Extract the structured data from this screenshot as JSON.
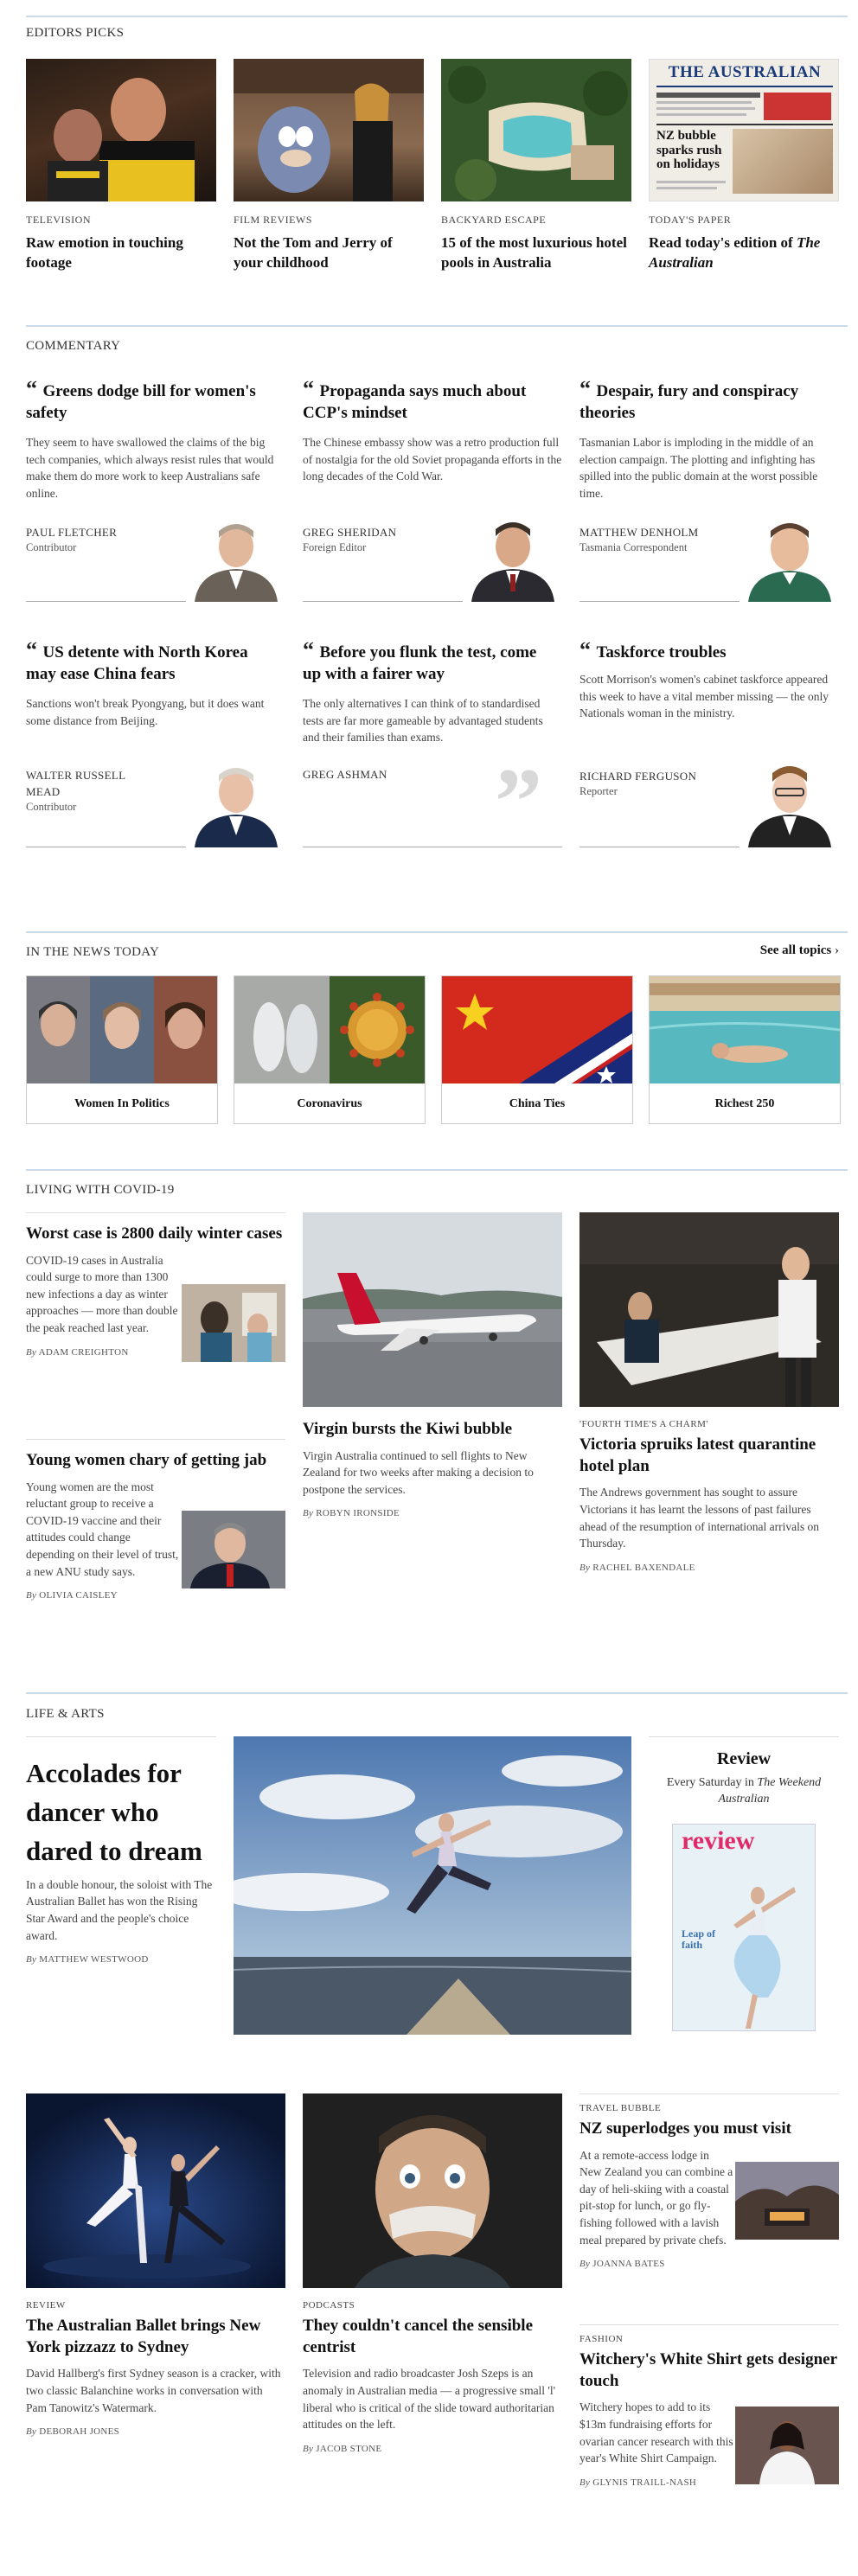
{
  "editors_picks": {
    "heading": "EDITORS PICKS",
    "items": [
      {
        "kicker": "TELEVISION",
        "title": "Raw emotion in touching footage"
      },
      {
        "kicker": "FILM REVIEWS",
        "title": "Not the Tom and Jerry of your childhood"
      },
      {
        "kicker": "BACKYARD ESCAPE",
        "title": "15 of the most luxurious hotel pools in Australia"
      },
      {
        "kicker": "TODAY'S PAPER",
        "title": "Read today's edition of",
        "title_em": "The Australian"
      }
    ],
    "paper": {
      "masthead": "THE AUSTRALIAN",
      "headline": "NZ bubble sparks rush on holidays"
    }
  },
  "commentary": {
    "heading": "COMMENTARY",
    "items": [
      {
        "title": "Greens dodge bill for women's safety",
        "body": "They seem to have swallowed the claims of the big tech companies, which always resist rules that would make them do more work to keep Australians safe online.",
        "name": "PAUL FLETCHER",
        "role": "Contributor"
      },
      {
        "title": "Propaganda says much about CCP's mindset",
        "body": "The Chinese embassy show was a retro production full of nostalgia for the old Soviet propaganda efforts in the long decades of the Cold War.",
        "name": "GREG SHERIDAN",
        "role": "Foreign Editor"
      },
      {
        "title": "Despair, fury and conspiracy theories",
        "body": "Tasmanian Labor is imploding in the middle of an election campaign. The plotting and infighting has spilled into the public domain at the worst possible time.",
        "name": "MATTHEW DENHOLM",
        "role": "Tasmania Correspondent"
      },
      {
        "title": "US detente with North Korea may ease China fears",
        "body": "Sanctions won't break Pyongyang, but it does want some distance from Beijing.",
        "name": "WALTER RUSSELL MEAD",
        "role": "Contributor"
      },
      {
        "title": "Before you flunk the test, come up with a fairer way",
        "body": "The only alternatives I can think of to standardised tests are far more gameable by advantaged students and their families than exams.",
        "name": "GREG ASHMAN",
        "role": ""
      },
      {
        "title": "Taskforce troubles",
        "body": "Scott Morrison's women's cabinet taskforce appeared this week to have a vital member missing — the only Nationals woman in the ministry.",
        "name": "RICHARD FERGUSON",
        "role": "Reporter"
      }
    ]
  },
  "in_the_news": {
    "heading": "IN THE NEWS TODAY",
    "see_all": "See all topics",
    "topics": [
      "Women In Politics",
      "Coronavirus",
      "China Ties",
      "Richest 250"
    ]
  },
  "covid": {
    "heading": "LIVING WITH COVID-19",
    "left": [
      {
        "title": "Worst case is 2800 daily winter cases",
        "body": "COVID-19 cases in Australia could surge to more than 1300 new infections a day as winter approaches — more than double the peak reached last year.",
        "by": "By",
        "author": "ADAM CREIGHTON"
      },
      {
        "title": "Young women chary of getting jab",
        "body": "Young women are the most reluctant group to receive a COVID-19 vaccine and their attitudes could change depending on their level of trust, a new ANU study says.",
        "by": "By",
        "author": "OLIVIA CAISLEY"
      }
    ],
    "middle": {
      "title": "Virgin bursts the Kiwi bubble",
      "body": "Virgin Australia continued to sell flights to New Zealand for two weeks after making a decision to postpone the services.",
      "by": "By",
      "author": "ROBYN IRONSIDE"
    },
    "right": {
      "kicker": "'FOURTH TIME'S A CHARM'",
      "title": "Victoria spruiks latest quarantine hotel plan",
      "body": "The Andrews government has sought to assure Victorians it has learnt the lessons of past failures ahead of the resumption of international arrivals on Thursday.",
      "by": "By",
      "author": "RACHEL BAXENDALE"
    }
  },
  "life_arts": {
    "heading": "LIFE & ARTS",
    "lead": {
      "title": "Accolades for dancer who dared to dream",
      "body": "In a double honour, the soloist with The Australian Ballet has won the Rising Star Award and the people's choice award.",
      "by": "By",
      "author": "MATTHEW WESTWOOD"
    },
    "review": {
      "title": "Review",
      "sub1": "Every Saturday in",
      "sub2": "The Weekend Australian",
      "cover_logo": "review",
      "cover_line": "Leap of faith"
    },
    "ballet": {
      "kicker": "REVIEW",
      "title": "The Australian Ballet brings New York pizzazz to Sydney",
      "body": "David Hallberg's first Sydney season is a cracker, with two classic Balanchine works in conversation with Pam Tanowitz's Watermark.",
      "by": "By",
      "author": "DEBORAH JONES"
    },
    "podcast": {
      "kicker": "PODCASTS",
      "title": "They couldn't cancel the sensible centrist",
      "body": "Television and radio broadcaster Josh Szeps is an anomaly in Australian media — a progressive small 'l' liberal who is critical of the slide toward authoritarian attitudes on the left.",
      "by": "By",
      "author": "JACOB STONE"
    },
    "travel": {
      "kicker": "TRAVEL BUBBLE",
      "title": "NZ superlodges you must visit",
      "body": "At a remote-access lodge in New Zealand you can combine a day of heli-skiing with a coastal pit-stop for lunch, or go fly-fishing followed with a lavish meal prepared by private chefs.",
      "by": "By",
      "author": "JOANNA BATES"
    },
    "fashion": {
      "kicker": "FASHION",
      "title": "Witchery's White Shirt gets designer touch",
      "body": "Witchery hopes to add to its $13m fundraising efforts for ovarian cancer research with this year's White Shirt Campaign.",
      "by": "By",
      "author": "GLYNIS TRAILL-NASH"
    }
  }
}
